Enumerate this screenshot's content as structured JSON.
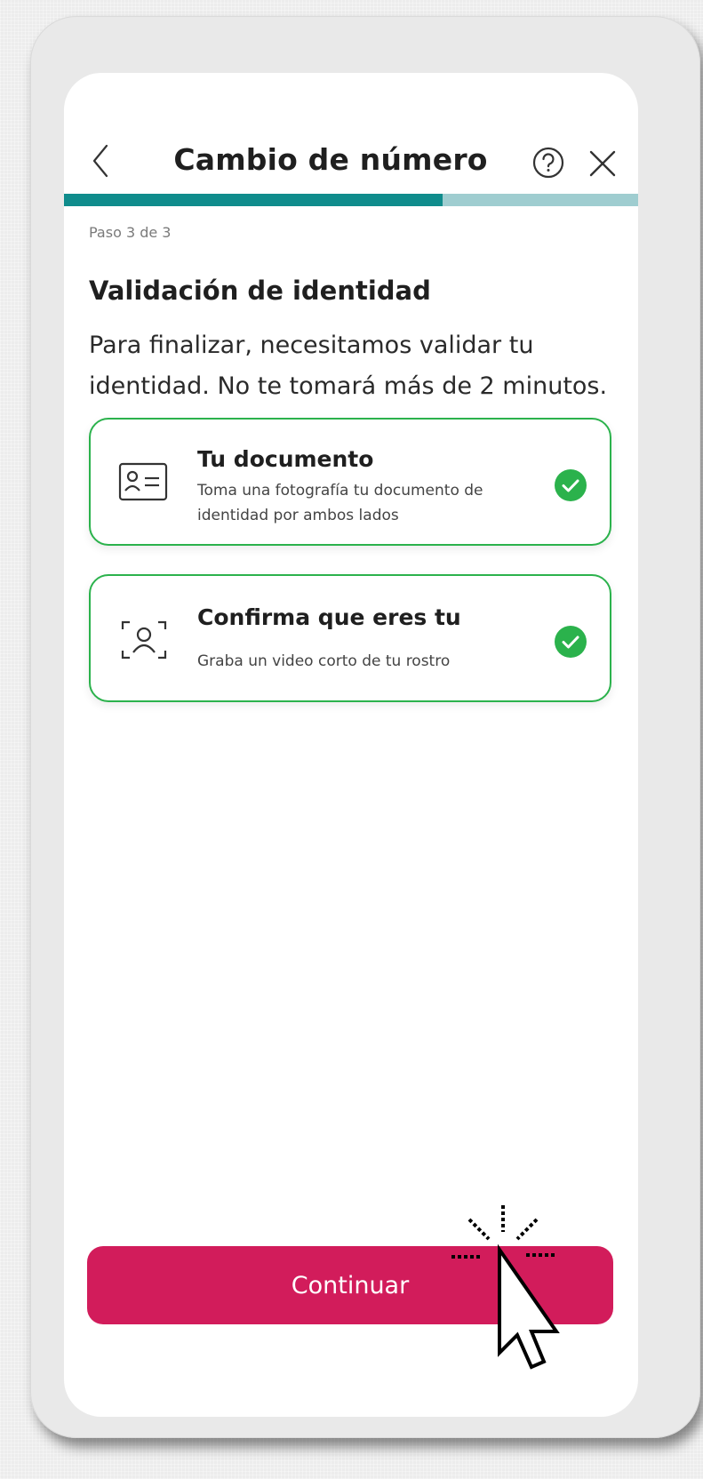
{
  "header": {
    "title": "Cambio de número",
    "back_icon": "chevron-left-icon",
    "help_icon": "help-circle-icon",
    "close_icon": "close-icon"
  },
  "progress": {
    "fraction": 0.66,
    "fill_color": "#0f8c8c",
    "track_color": "#9fcdd0"
  },
  "step_label": "Paso 3 de 3",
  "section": {
    "title": "Validación de identidad",
    "description": "Para finalizar, necesitamos validar tu identidad. No te tomará más de 2 minutos."
  },
  "cards": [
    {
      "title": "Tu documento",
      "subtitle": "Toma una fotografía tu documento de identidad por ambos lados",
      "icon": "id-card-icon",
      "status_icon": "check-circle-icon"
    },
    {
      "title": "Confirma que eres tu",
      "subtitle": "Graba un video corto de tu rostro",
      "icon": "face-scan-icon",
      "status_icon": "check-circle-icon"
    }
  ],
  "cta": {
    "label": "Continuar",
    "color": "#d21c5b"
  },
  "colors": {
    "success": "#2bb24c",
    "accent": "#0f8c8c"
  }
}
